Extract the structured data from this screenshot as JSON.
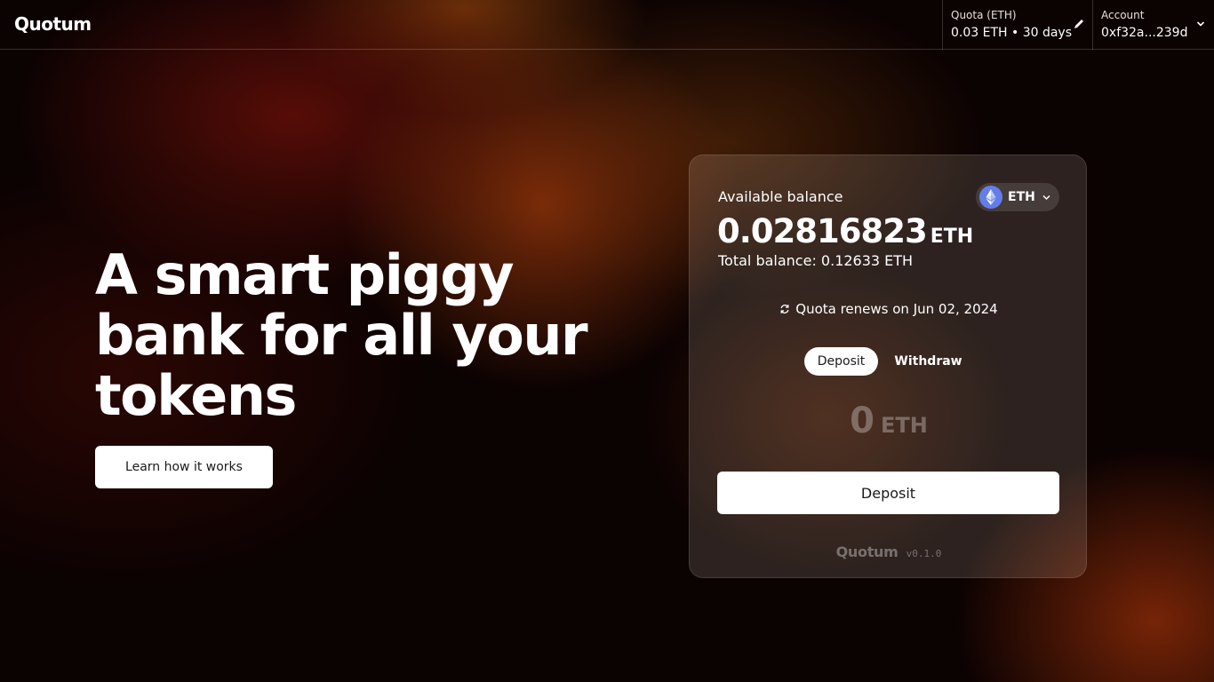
{
  "header": {
    "logo": "Quotum",
    "quota": {
      "label": "Quota (ETH)",
      "value": "0.03 ETH • 30 days"
    },
    "account": {
      "label": "Account",
      "value": "0xf32a...239d"
    }
  },
  "hero": {
    "title": "A smart piggy bank for all your tokens",
    "learn_button": "Learn how it works"
  },
  "card": {
    "available_label": "Available balance",
    "token": {
      "symbol": "ETH",
      "icon": "ethereum-icon",
      "icon_bg": "#627eea"
    },
    "balance_value": "0.02816823",
    "balance_unit": "ETH",
    "total_balance": "Total balance: 0.12633 ETH",
    "renew_text": "Quota renews on Jun 02, 2024",
    "tabs": [
      {
        "label": "Deposit",
        "active": true
      },
      {
        "label": "Withdraw",
        "active": false
      }
    ],
    "amount_value": "0",
    "amount_unit": "ETH",
    "deposit_button": "Deposit",
    "footer_logo": "Quotum",
    "footer_version": "v0.1.0"
  }
}
